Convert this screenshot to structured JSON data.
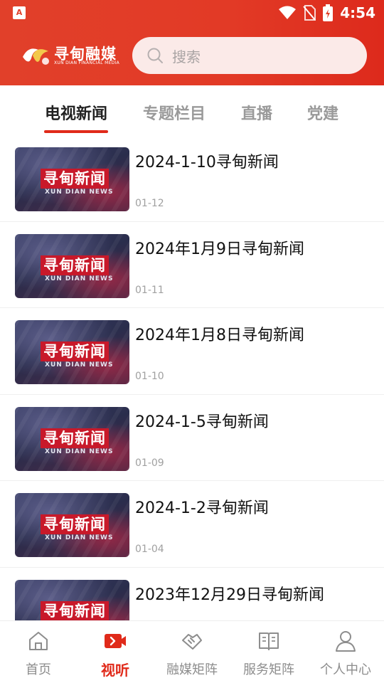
{
  "status_bar": {
    "time": "4:54",
    "left_icon": "A"
  },
  "header": {
    "logo_text": "寻甸融媒",
    "logo_subtitle": "XUN DIAN FINANCIAL MEDIA",
    "search_placeholder": "搜索"
  },
  "tabs": [
    {
      "label": "电视新闻",
      "active": true
    },
    {
      "label": "专题栏目",
      "active": false
    },
    {
      "label": "直播",
      "active": false
    },
    {
      "label": "党建",
      "active": false
    }
  ],
  "thumbnail": {
    "title": "寻甸新闻",
    "subtitle": "XUN DIAN NEWS"
  },
  "news_items": [
    {
      "title": "2024-1-10寻甸新闻",
      "date": "01-12"
    },
    {
      "title": "2024年1月9日寻甸新闻",
      "date": "01-11"
    },
    {
      "title": "2024年1月8日寻甸新闻",
      "date": "01-10"
    },
    {
      "title": "2024-1-5寻甸新闻",
      "date": "01-09"
    },
    {
      "title": "2024-1-2寻甸新闻",
      "date": "01-04"
    },
    {
      "title": "2023年12月29日寻甸新闻",
      "date": ""
    }
  ],
  "bottom_nav": [
    {
      "label": "首页",
      "icon": "home-icon",
      "active": false
    },
    {
      "label": "视听",
      "icon": "video-icon",
      "active": true
    },
    {
      "label": "融媒矩阵",
      "icon": "handshake-icon",
      "active": false
    },
    {
      "label": "服务矩阵",
      "icon": "book-icon",
      "active": false
    },
    {
      "label": "个人中心",
      "icon": "user-icon",
      "active": false
    }
  ],
  "colors": {
    "brand_red": "#e02a1a",
    "header_start": "#e1402a",
    "header_end": "#dd2a1c"
  }
}
